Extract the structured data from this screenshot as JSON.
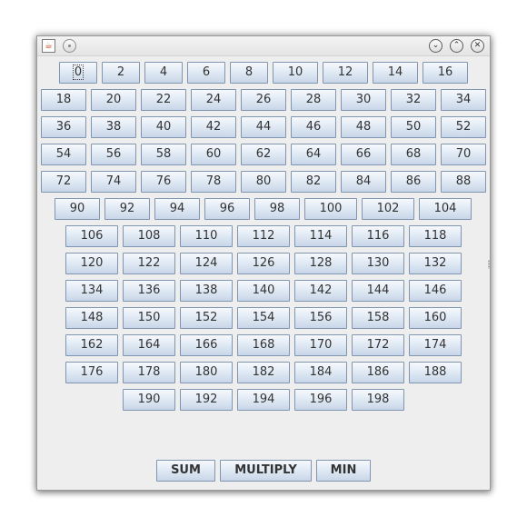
{
  "window": {
    "title_icon": "java-cup-icon",
    "buttons": [
      "minimize",
      "maximize",
      "close"
    ]
  },
  "number_buttons": [
    "0",
    "2",
    "4",
    "6",
    "8",
    "10",
    "12",
    "14",
    "16",
    "18",
    "20",
    "22",
    "24",
    "26",
    "28",
    "30",
    "32",
    "34",
    "36",
    "38",
    "40",
    "42",
    "44",
    "46",
    "48",
    "50",
    "52",
    "54",
    "56",
    "58",
    "60",
    "62",
    "64",
    "66",
    "68",
    "70",
    "72",
    "74",
    "76",
    "78",
    "80",
    "82",
    "84",
    "86",
    "88",
    "90",
    "92",
    "94",
    "96",
    "98",
    "100",
    "102",
    "104",
    "106",
    "108",
    "110",
    "112",
    "114",
    "116",
    "118",
    "120",
    "122",
    "124",
    "126",
    "128",
    "130",
    "132",
    "134",
    "136",
    "138",
    "140",
    "142",
    "144",
    "146",
    "148",
    "150",
    "152",
    "154",
    "156",
    "158",
    "160",
    "162",
    "164",
    "166",
    "168",
    "170",
    "172",
    "174",
    "176",
    "178",
    "180",
    "182",
    "184",
    "186",
    "188",
    "190",
    "192",
    "194",
    "196",
    "198"
  ],
  "focused_button": "0",
  "actions": {
    "sum": "SUM",
    "multiply": "MULTIPLY",
    "min": "MIN"
  },
  "colors": {
    "button_border": "#8095b0",
    "button_top": "#f6f9fd",
    "button_bottom": "#c8d6e8",
    "window_bg": "#eeeeee"
  }
}
